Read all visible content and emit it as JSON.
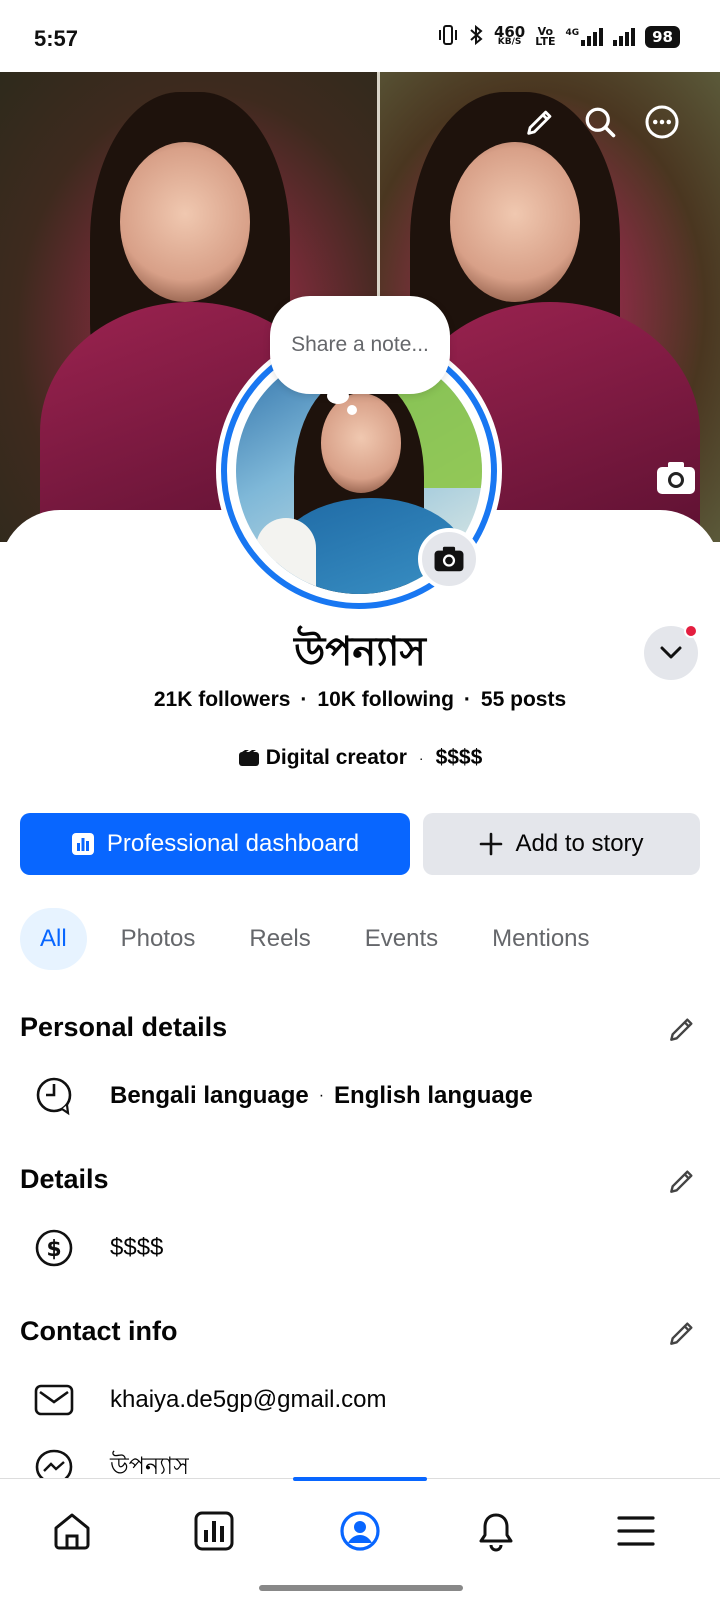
{
  "status_bar": {
    "time": "5:57",
    "net_speed_top": "460",
    "net_speed_bottom": "KB/S",
    "volte_top": "Vo",
    "volte_bottom": "LTE",
    "network_type": "4G",
    "battery": "98"
  },
  "cover": {
    "edit_icon": "pencil-icon",
    "search_icon": "search-icon",
    "more_icon": "more-dots-icon",
    "camera_icon": "camera-icon"
  },
  "note": {
    "placeholder": "Share a note..."
  },
  "profile": {
    "name": "উপন্যাস",
    "followers": "21K followers",
    "following": "10K following",
    "posts": "55 posts",
    "stats_separator": "·",
    "category": "Digital creator",
    "category_separator": "·",
    "price_range": "$$$$"
  },
  "actions": {
    "primary_label": "Professional dashboard",
    "secondary_label": "Add to story"
  },
  "tabs": [
    {
      "label": "All",
      "active": true
    },
    {
      "label": "Photos",
      "active": false
    },
    {
      "label": "Reels",
      "active": false
    },
    {
      "label": "Events",
      "active": false
    },
    {
      "label": "Mentions",
      "active": false
    }
  ],
  "personal_details": {
    "title": "Personal details",
    "language_1": "Bengali language",
    "separator": "·",
    "language_2": "English language"
  },
  "details": {
    "title": "Details",
    "price_range": "$$$$"
  },
  "contact_info": {
    "title": "Contact info",
    "email": "khaiya.de5gp@gmail.com",
    "messenger": "উপন্যাস"
  },
  "colors": {
    "accent": "#0866ff",
    "ring": "#1877f2",
    "notification": "#e41e3f",
    "secondary_button": "#e4e6eb"
  }
}
